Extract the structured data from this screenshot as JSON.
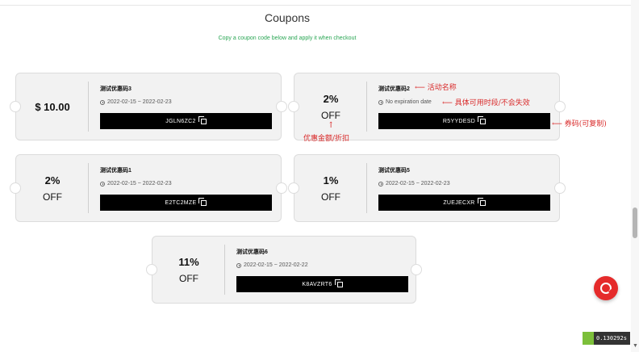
{
  "page": {
    "title": "Coupons",
    "subtitle": "Copy a coupon code below and apply it when checkout"
  },
  "coupons": [
    {
      "value_main": "$ 10.00",
      "value_off": "",
      "name": "测试优惠码3",
      "dates": "2022-02-15 ~ 2022-02-23",
      "code": "JGLN6ZC2"
    },
    {
      "value_main": "2%",
      "value_off": "OFF",
      "name": "测试优惠码2",
      "dates": "No expiration date",
      "code": "R5YYDESD"
    },
    {
      "value_main": "2%",
      "value_off": "OFF",
      "name": "测试优惠码1",
      "dates": "2022-02-15 ~ 2022-02-23",
      "code": "E2TC2MZE"
    },
    {
      "value_main": "1%",
      "value_off": "OFF",
      "name": "测试优惠码5",
      "dates": "2022-02-15 ~ 2022-02-23",
      "code": "ZUEJECXR"
    },
    {
      "value_main": "11%",
      "value_off": "OFF",
      "name": "测试优惠码6",
      "dates": "2022-02-15 ~ 2022-02-22",
      "code": "K8AVZRT6"
    }
  ],
  "annotations": {
    "event_name": "活动名称",
    "valid_period": "具体可用时段/不会失效",
    "coupon_code": "券码(可复制)",
    "discount": "优惠金额/折扣"
  },
  "timer": {
    "value": "0.130292s"
  },
  "colors": {
    "accent": "#e52b2b",
    "code_bg": "#000000",
    "card_bg": "#f2f2f2",
    "subtitle": "#2aa654",
    "annotation": "#d92a2a"
  },
  "icons": {
    "clock": "clock-icon",
    "copy": "copy-icon",
    "chat": "chat-icon"
  }
}
